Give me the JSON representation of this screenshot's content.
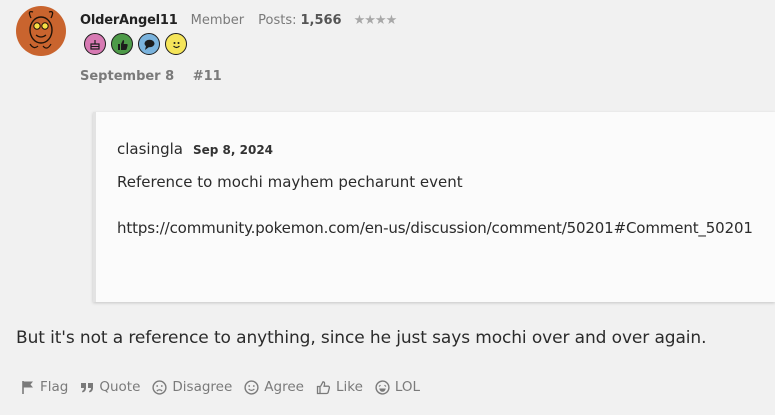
{
  "post": {
    "author": {
      "name": "OlderAngel11",
      "role": "Member",
      "posts_label": "Posts:",
      "posts_count": "1,566",
      "rank_stars": "★★★★"
    },
    "badges": [
      "birthday-cake-icon",
      "thumbs-up-icon",
      "speech-bubble-icon",
      "smiley-icon"
    ],
    "date": "September 8",
    "post_number": "#11",
    "quote": {
      "username": "clasingla",
      "date": "Sep 8, 2024",
      "text": "Reference to mochi mayhem pecharunt event",
      "link": "https://community.pokemon.com/en-us/discussion/comment/50201#Comment_50201"
    },
    "body": "But it's not a reference to anything, since he just says mochi over and over again.",
    "actions": {
      "flag": "Flag",
      "quote": "Quote",
      "disagree": "Disagree",
      "agree": "Agree",
      "like": "Like",
      "lol": "LOL"
    }
  },
  "colors": {
    "background": "#f1f1f1",
    "avatar_bg": "#c9642e",
    "muted_text": "#7a7a7a"
  }
}
